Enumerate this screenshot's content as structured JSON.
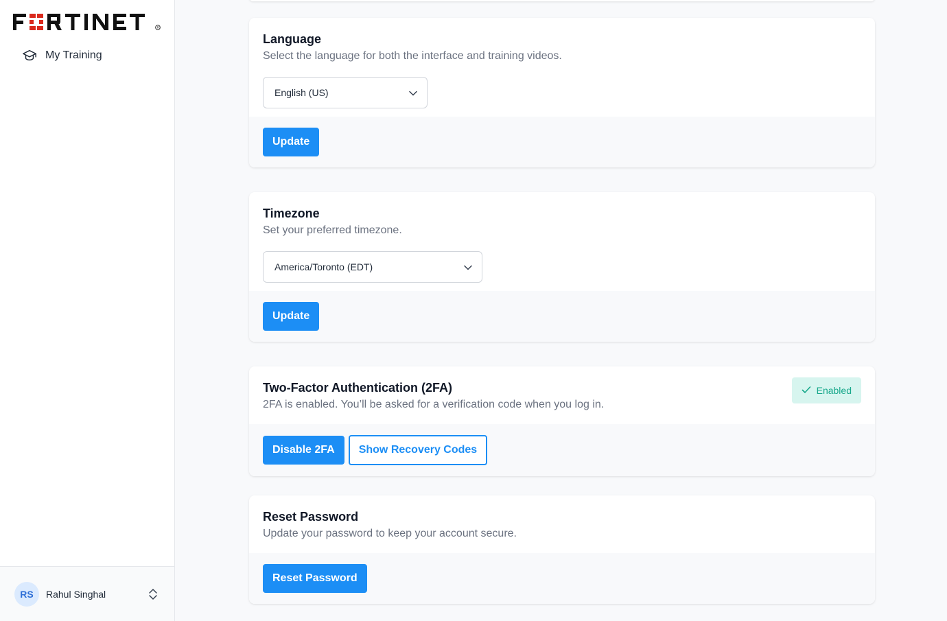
{
  "brand": {
    "logo_text": "FORTINET"
  },
  "sidebar": {
    "items": [
      {
        "label": "My Training",
        "icon": "graduation-cap-icon"
      }
    ],
    "user": {
      "initials": "RS",
      "name": "Rahul Singhal"
    }
  },
  "language": {
    "title": "Language",
    "description": "Select the language for both the interface and training videos.",
    "selected": "English (US)",
    "button": "Update"
  },
  "timezone": {
    "title": "Timezone",
    "description": "Set your preferred timezone.",
    "selected": "America/Toronto (EDT)",
    "button": "Update"
  },
  "twofa": {
    "title": "Two-Factor Authentication (2FA)",
    "description": "2FA is enabled. You’ll be asked for a verification code when you log in.",
    "status": "Enabled",
    "disable_button": "Disable 2FA",
    "recovery_button": "Show Recovery Codes"
  },
  "reset": {
    "title": "Reset Password",
    "description": "Update your password to keep your account secure.",
    "button": "Reset Password"
  },
  "colors": {
    "accent": "#1c8ef5",
    "success_bg": "#d7f5ef",
    "success_text": "#17a88b",
    "brand_red": "#da291c"
  }
}
